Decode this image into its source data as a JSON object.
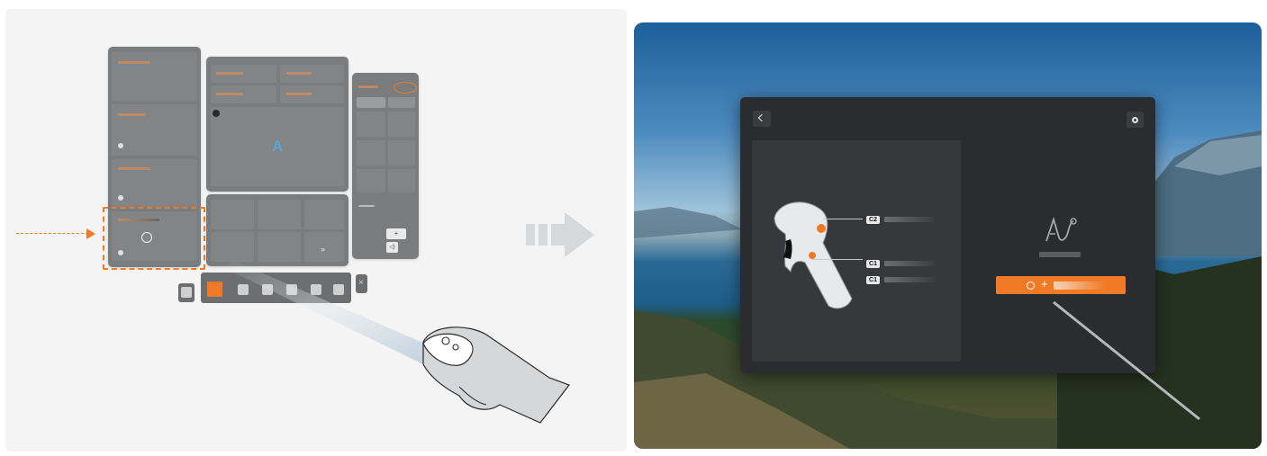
{
  "panel_right": {
    "item_plus": "+",
    "item_sound": "◁)"
  },
  "tab_bar": {
    "close_label": "×"
  },
  "nav_marker": "A",
  "dock_more": "»",
  "dialog": {
    "buttons": [
      {
        "label": "C2"
      },
      {
        "label": "C1"
      },
      {
        "label": "C1"
      }
    ],
    "action_plus": "+"
  },
  "colors": {
    "accent": "#f07a25",
    "dialog_bg": "#2a2c2f"
  }
}
